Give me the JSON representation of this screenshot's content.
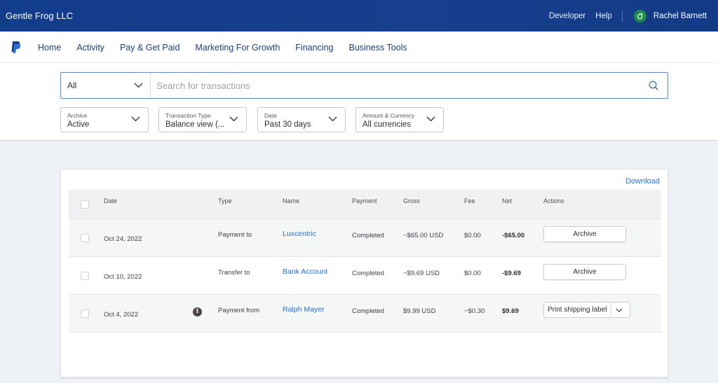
{
  "topbar": {
    "org_name": "Gentle Frog LLC",
    "links": [
      "Developer",
      "Help"
    ],
    "user_name": "Rachel Barnett",
    "avatar_icon": "frog-avatar-icon"
  },
  "nav": {
    "logo_icon": "paypal-logo-icon",
    "items": [
      "Home",
      "Activity",
      "Pay & Get Paid",
      "Marketing For Growth",
      "Financing",
      "Business Tools"
    ]
  },
  "search": {
    "scope_value": "All",
    "placeholder": "Search for transactions",
    "value": ""
  },
  "filters": [
    {
      "label": "Archive",
      "value": "Active"
    },
    {
      "label": "Transaction Type",
      "value": "Balance view (..."
    },
    {
      "label": "Date",
      "value": "Past 30 days"
    },
    {
      "label": "Amount & Currency",
      "value": "All currencies"
    }
  ],
  "table": {
    "download_label": "Download",
    "columns": [
      "Date",
      "Type",
      "Name",
      "Payment",
      "Gross",
      "Fee",
      "Net",
      "Actions"
    ],
    "rows": [
      {
        "date": "Oct 24, 2022",
        "type": "Payment to",
        "name": "Luxcentric",
        "payment": "Completed",
        "gross": "−$65.00 USD",
        "fee": "$0.00",
        "net": "-$65.00",
        "action": "Archive"
      },
      {
        "date": "Oct 10, 2022",
        "type": "Transfer to",
        "name": "Bank Account",
        "payment": "Completed",
        "gross": "−$9.69 USD",
        "fee": "$0.00",
        "net": "-$9.69",
        "action": "Archive"
      },
      {
        "date": "Oct 4, 2022",
        "type": "Payment from",
        "name": "Ralph Mayer",
        "payment": "Completed",
        "gross": "$9.99 USD",
        "fee": "−$0.30",
        "net": "$9.69",
        "action": "Print shipping label",
        "info_icon": "i"
      }
    ]
  },
  "colors": {
    "header_bg": "#123c8c",
    "link_blue": "#1f73d1",
    "nav_text": "#1d3e7a",
    "avatar_green": "#1e8a4b"
  }
}
